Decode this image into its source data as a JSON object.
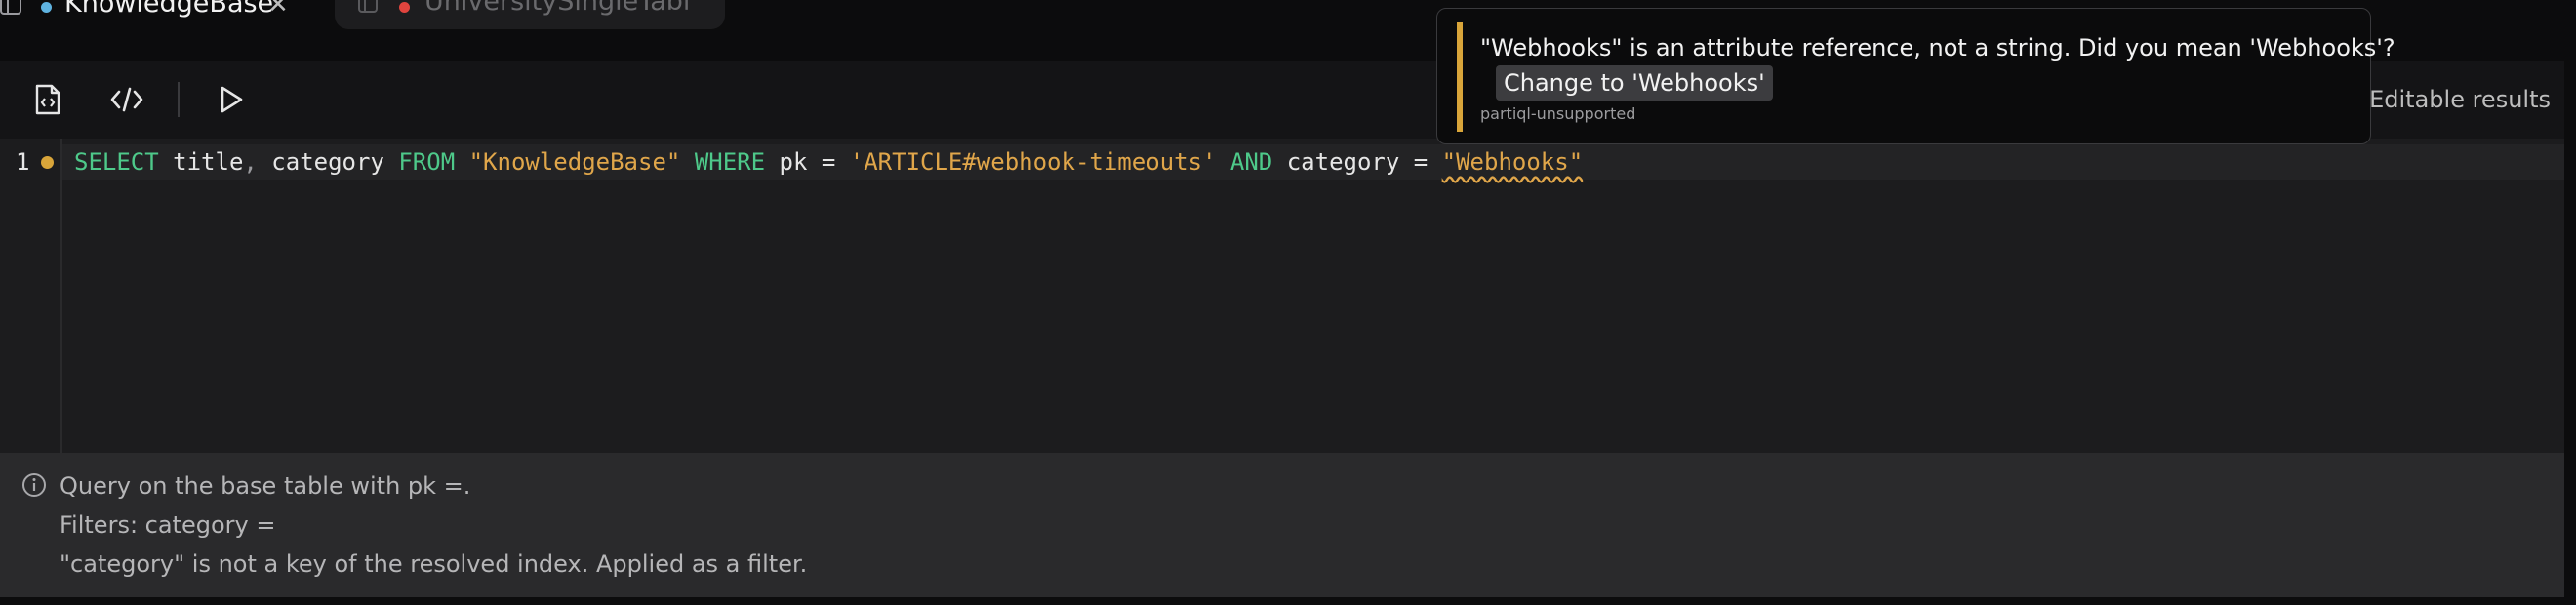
{
  "tabs": [
    {
      "title": "KnowledgeBase",
      "close_glyph": "✕",
      "active": true,
      "dot_color": "#5fb3e0"
    },
    {
      "title": "UniversitySingleTabl",
      "active": false,
      "dot_color": "#e0443e"
    }
  ],
  "toolbar": {
    "buttons": [
      "file-code-icon",
      "code-icon",
      "run-icon"
    ],
    "editable_results_label": "Editable results"
  },
  "editor": {
    "line_number": "1",
    "tokens": [
      {
        "text": "SELECT",
        "cls": "kw"
      },
      {
        "text": " title",
        "cls": ""
      },
      {
        "text": ",",
        "cls": "punct"
      },
      {
        "text": " category ",
        "cls": ""
      },
      {
        "text": "FROM",
        "cls": "kw"
      },
      {
        "text": " ",
        "cls": ""
      },
      {
        "text": "\"KnowledgeBase\"",
        "cls": "str"
      },
      {
        "text": " ",
        "cls": ""
      },
      {
        "text": "WHERE",
        "cls": "kw"
      },
      {
        "text": " pk = ",
        "cls": ""
      },
      {
        "text": "'ARTICLE#webhook-timeouts'",
        "cls": "str"
      },
      {
        "text": " ",
        "cls": ""
      },
      {
        "text": "AND",
        "cls": "kw"
      },
      {
        "text": " category = ",
        "cls": ""
      },
      {
        "text": "\"Webhooks\"",
        "cls": "str squig"
      }
    ]
  },
  "tooltip": {
    "message": "\"Webhooks\" is an attribute reference, not a string. Did you mean 'Webhooks'?",
    "action_label": "Change to 'Webhooks'",
    "code": "partiql-unsupported"
  },
  "info": {
    "lines": [
      "Query on the base table with pk =.",
      "Filters: category =",
      "\"category\" is not a key of the resolved index. Applied as a filter."
    ]
  },
  "colors": {
    "accent_warning": "#d9a53a",
    "keyword": "#4ec98a",
    "string": "#e0a64a"
  }
}
